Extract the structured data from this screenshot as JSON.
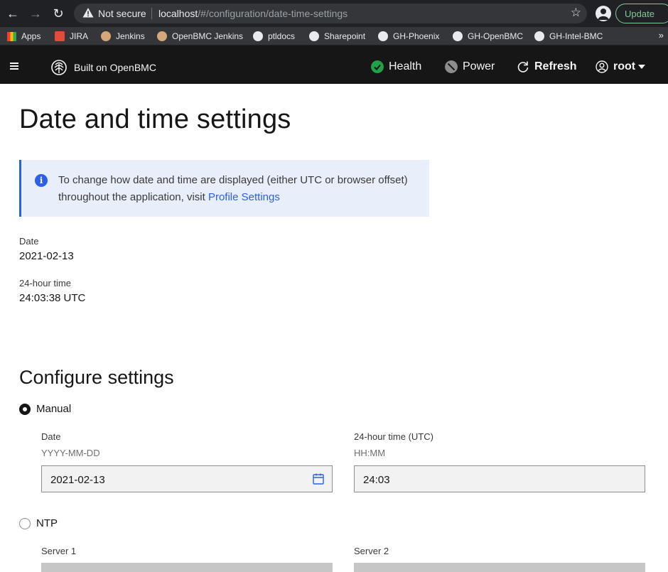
{
  "browser": {
    "security_label": "Not secure",
    "url_host": "localhost",
    "url_path": "/#/configuration/date-time-settings",
    "update_label": "Update",
    "bookmarks": [
      "Apps",
      "JIRA",
      "Jenkins",
      "OpenBMC Jenkins",
      "ptldocs",
      "Sharepoint",
      "GH-Phoenix",
      "GH-OpenBMC",
      "GH-Intel-BMC"
    ],
    "more_label": "»"
  },
  "header": {
    "brand": "Built on OpenBMC",
    "health_label": "Health",
    "power_label": "Power",
    "refresh_label": "Refresh",
    "user_label": "root"
  },
  "page": {
    "title": "Date and time settings",
    "info_text": "To change how date and time are displayed (either UTC or browser offset) throughout the application, visit ",
    "info_link": "Profile Settings",
    "date_label": "Date",
    "date_value": "2021-02-13",
    "time_label": "24-hour time",
    "time_value": "24:03:38 UTC"
  },
  "configure": {
    "title": "Configure settings",
    "manual_label": "Manual",
    "manual_date_label": "Date",
    "manual_date_hint": "YYYY-MM-DD",
    "manual_date_value": "2021-02-13",
    "manual_time_label": "24-hour time (UTC)",
    "manual_time_hint": "HH:MM",
    "manual_time_value": "24:03",
    "ntp_label": "NTP",
    "server1_label": "Server 1",
    "server2_label": "Server 2"
  },
  "colors": {
    "accent": "#2d60e8",
    "health_ok": "#24a148",
    "header_bg": "#161616"
  }
}
